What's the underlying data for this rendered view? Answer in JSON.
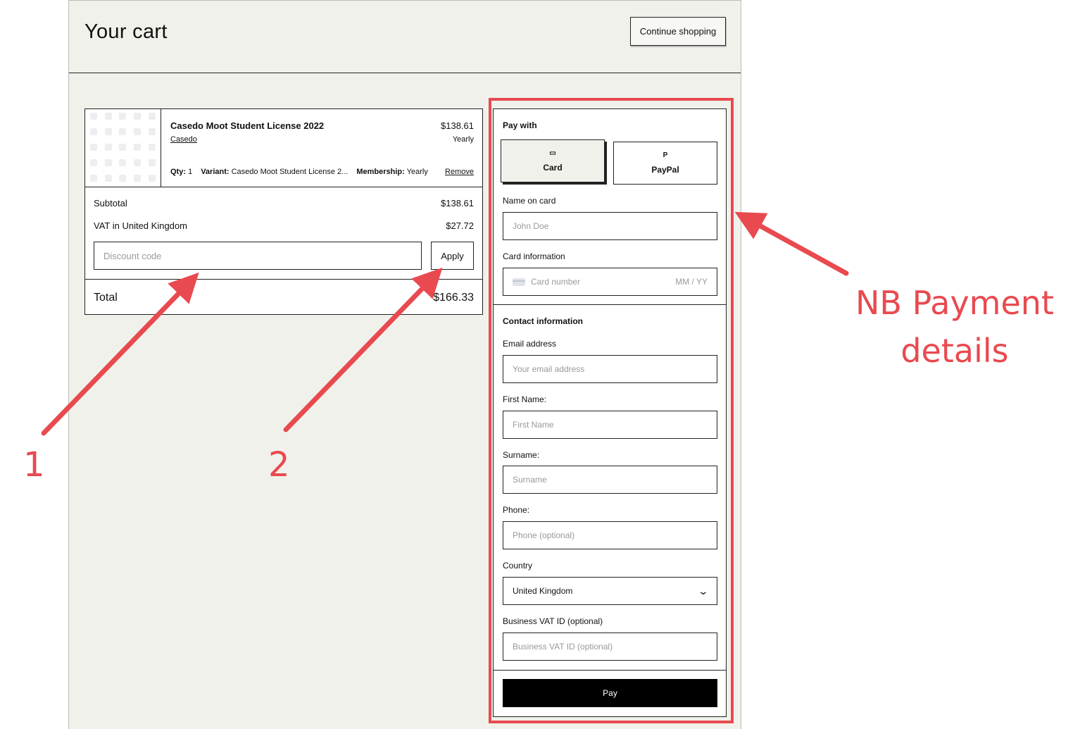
{
  "header": {
    "title": "Your cart",
    "continue_label": "Continue shopping"
  },
  "cart": {
    "item": {
      "name": "Casedo Moot Student License 2022",
      "brand": "Casedo",
      "price": "$138.61",
      "cycle": "Yearly",
      "qty_label": "Qty:",
      "qty_value": "1",
      "variant_label": "Variant:",
      "variant_value": "Casedo Moot Student License 2...",
      "membership_label": "Membership:",
      "membership_value": "Yearly",
      "remove_label": "Remove"
    },
    "subtotal_label": "Subtotal",
    "subtotal_value": "$138.61",
    "vat_label": "VAT in United Kingdom",
    "vat_value": "$27.72",
    "discount_placeholder": "Discount code",
    "apply_label": "Apply",
    "total_label": "Total",
    "total_value": "$166.33"
  },
  "payment": {
    "pay_with_label": "Pay with",
    "options": [
      {
        "label": "Card",
        "icon": "credit-card-icon",
        "selected": true
      },
      {
        "label": "PayPal",
        "icon": "paypal-icon",
        "selected": false
      }
    ],
    "name_label": "Name on card",
    "name_placeholder": "John Doe",
    "card_label": "Card information",
    "card_placeholder": "Card number",
    "expiry_placeholder": "MM / YY",
    "contact_label": "Contact information",
    "email_label": "Email address",
    "email_placeholder": "Your email address",
    "first_name_label": "First Name:",
    "first_name_placeholder": "First Name",
    "surname_label": "Surname:",
    "surname_placeholder": "Surname",
    "phone_label": "Phone:",
    "phone_placeholder": "Phone (optional)",
    "country_label": "Country",
    "country_value": "United Kingdom",
    "vat_id_label": "Business VAT ID (optional)",
    "vat_id_placeholder": "Business VAT ID (optional)",
    "pay_label": "Pay"
  },
  "annotations": {
    "num1": "1",
    "num2": "2",
    "text_line1": "NB Payment",
    "text_line2": "details",
    "color": "#e84a4f"
  }
}
